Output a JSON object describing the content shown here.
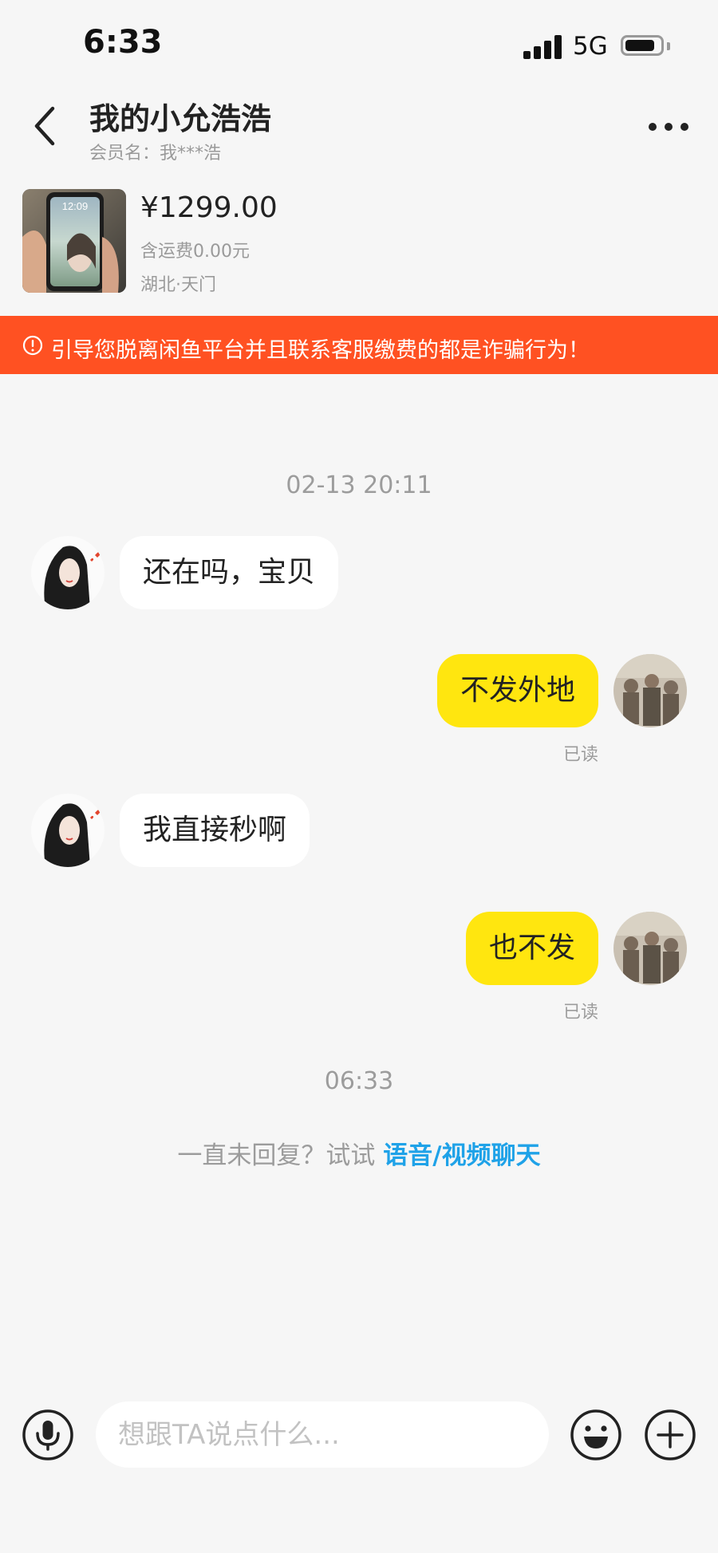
{
  "status_bar": {
    "time": "6:33",
    "network": "5G",
    "battery_level": 0.85
  },
  "header": {
    "title": "我的小允浩浩",
    "subtitle": "会员名：我***浩",
    "back_icon": "chevron-left-icon",
    "more_icon": "more-horizontal-icon"
  },
  "product": {
    "price": "¥1299.00",
    "shipping": "含运费0.00元",
    "location": "湖北·天门",
    "thumb_time": "12:09"
  },
  "warning": {
    "text": "引导您脱离闲鱼平台并且联系客服缴费的都是诈骗行为！",
    "icon": "alert-circle-icon",
    "color": "#ff5122"
  },
  "chat": {
    "timestamp_1": "02-13 20:11",
    "messages": [
      {
        "from": "other",
        "text": "还在吗，宝贝"
      },
      {
        "from": "me",
        "text": "不发外地",
        "status": "已读"
      },
      {
        "from": "other",
        "text": "我直接秒啊"
      },
      {
        "from": "me",
        "text": "也不发",
        "status": "已读"
      }
    ],
    "timestamp_2": "06:33",
    "prompt_text": "一直未回复？试试 ",
    "prompt_link": "语音/视频聊天"
  },
  "input_bar": {
    "placeholder": "想跟TA说点什么...",
    "mic_icon": "microphone-icon",
    "emoji_icon": "emoji-icon",
    "plus_icon": "plus-icon"
  },
  "colors": {
    "accent_link": "#1fa2e8",
    "my_bubble": "#ffe60f",
    "warning_bg": "#ff5122"
  }
}
